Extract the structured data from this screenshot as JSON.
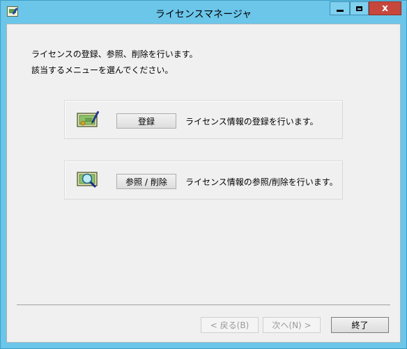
{
  "window": {
    "title": "ライセンスマネージャ",
    "close_glyph": "x",
    "icon": "app-license-icon"
  },
  "intro": {
    "line1": "ライセンスの登録、参照、削除を行います。",
    "line2": "該当するメニューを選んでください。"
  },
  "options": [
    {
      "icon": "certificate-pen-icon",
      "button_label": "登録",
      "description": "ライセンス情報の登録を行います。"
    },
    {
      "icon": "certificate-magnifier-icon",
      "button_label": "参照 / 削除",
      "description": "ライセンス情報の参照/削除を行います。"
    }
  ],
  "footer": {
    "back_label": "< 戻る(B)",
    "next_label": "次へ(N) >",
    "finish_label": "終了"
  },
  "colors": {
    "titlebar": "#6bc6ea",
    "close_button": "#c7473c",
    "client_background": "#f0f0f0"
  }
}
